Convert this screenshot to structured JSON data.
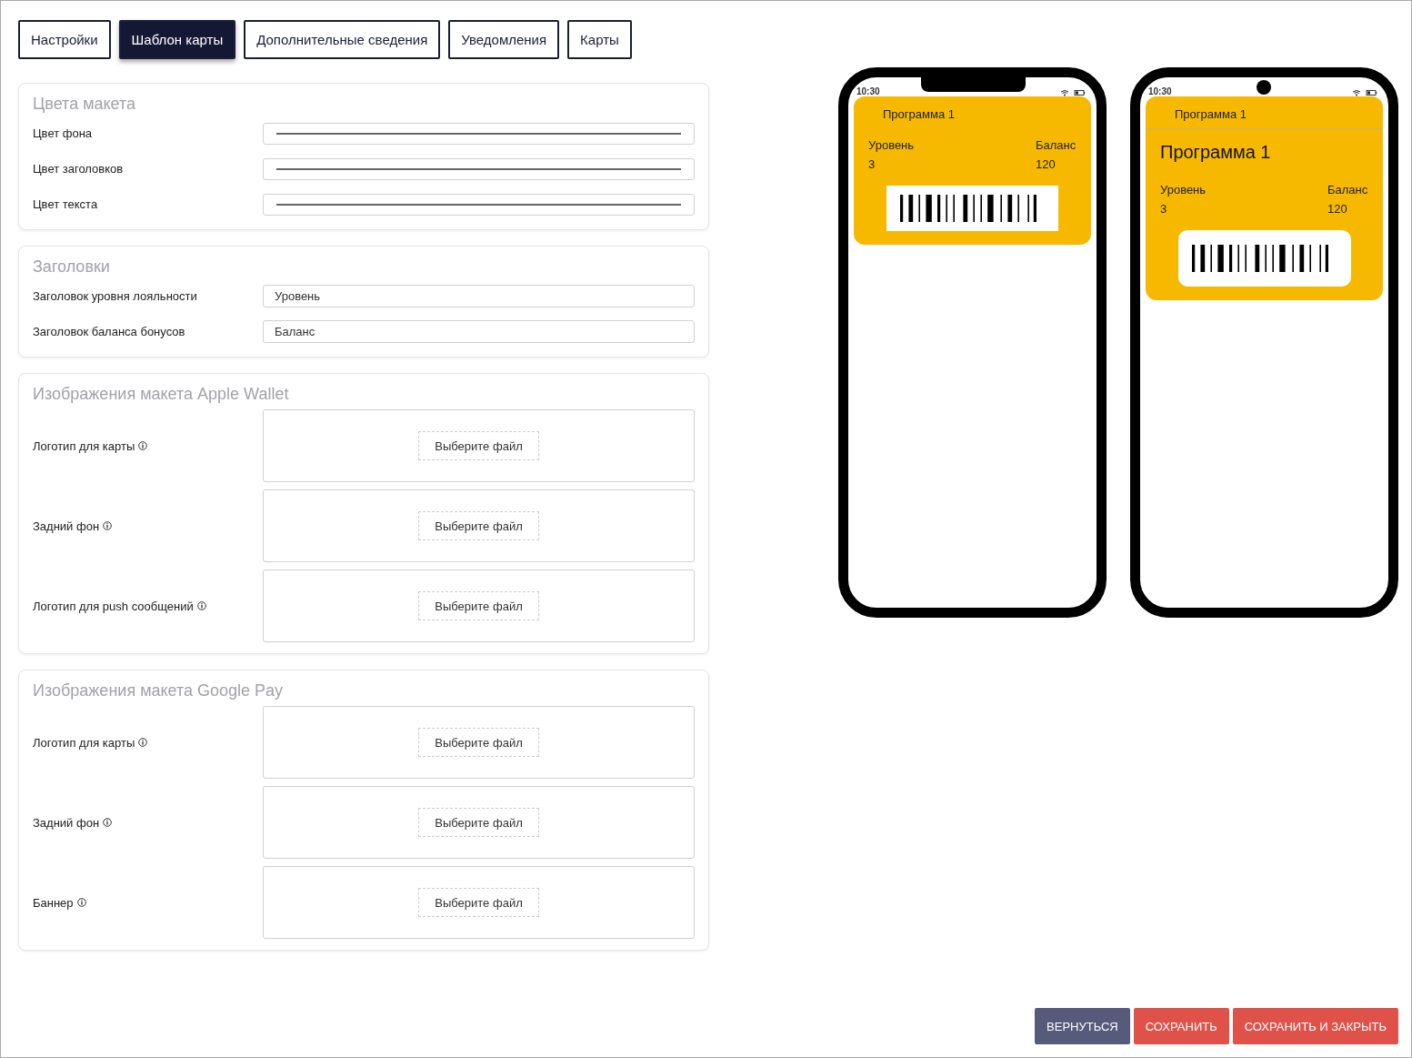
{
  "tabs": [
    {
      "label": "Настройки",
      "selected": false
    },
    {
      "label": "Шаблон карты",
      "selected": true
    },
    {
      "label": "Дополнительные сведения",
      "selected": false
    },
    {
      "label": "Уведомления",
      "selected": false
    },
    {
      "label": "Карты",
      "selected": false
    }
  ],
  "sections": [
    {
      "title": "Цвета макета",
      "fields": [
        {
          "kind": "color",
          "label": "Цвет фона"
        },
        {
          "kind": "color",
          "label": "Цвет заголовков"
        },
        {
          "kind": "color",
          "label": "Цвет текста"
        }
      ]
    },
    {
      "title": "Заголовки",
      "fields": [
        {
          "kind": "text",
          "label": "Заголовок уровня лояльности",
          "value": "Уровень"
        },
        {
          "kind": "text",
          "label": "Заголовок баланса бонусов",
          "value": "Баланс"
        }
      ]
    },
    {
      "title": "Изображения макета Apple Wallet",
      "fields": [
        {
          "kind": "file",
          "label": "Логотип для карты",
          "button": "Выберите файл"
        },
        {
          "kind": "file",
          "label": "Задний фон",
          "button": "Выберите файл"
        },
        {
          "kind": "file",
          "label": "Логотип для push сообщений",
          "button": "Выберите файл"
        }
      ]
    },
    {
      "title": "Изображения макета Google Pay",
      "fields": [
        {
          "kind": "file",
          "label": "Логотип для карты",
          "button": "Выберите файл"
        },
        {
          "kind": "file",
          "label": "Задний фон",
          "button": "Выберите файл"
        },
        {
          "kind": "file",
          "label": "Баннер",
          "button": "Выберите файл"
        }
      ]
    }
  ],
  "previews": [
    {
      "kind": "apple",
      "time": "10:30",
      "header": "Программа 1",
      "level_label": "Уровень",
      "level_value": "3",
      "balance_label": "Баланс",
      "balance_value": "120"
    },
    {
      "kind": "google",
      "time": "10:30",
      "header": "Программа 1",
      "title": "Программа 1",
      "level_label": "Уровень",
      "level_value": "3",
      "balance_label": "Баланс",
      "balance_value": "120"
    }
  ],
  "actions": [
    {
      "kind": "back",
      "label": "ВЕРНУТЬСЯ"
    },
    {
      "kind": "save",
      "label": "СОХРАНИТЬ"
    },
    {
      "kind": "save",
      "label": "СОХРАНИТЬ И ЗАКРЫТЬ"
    }
  ]
}
